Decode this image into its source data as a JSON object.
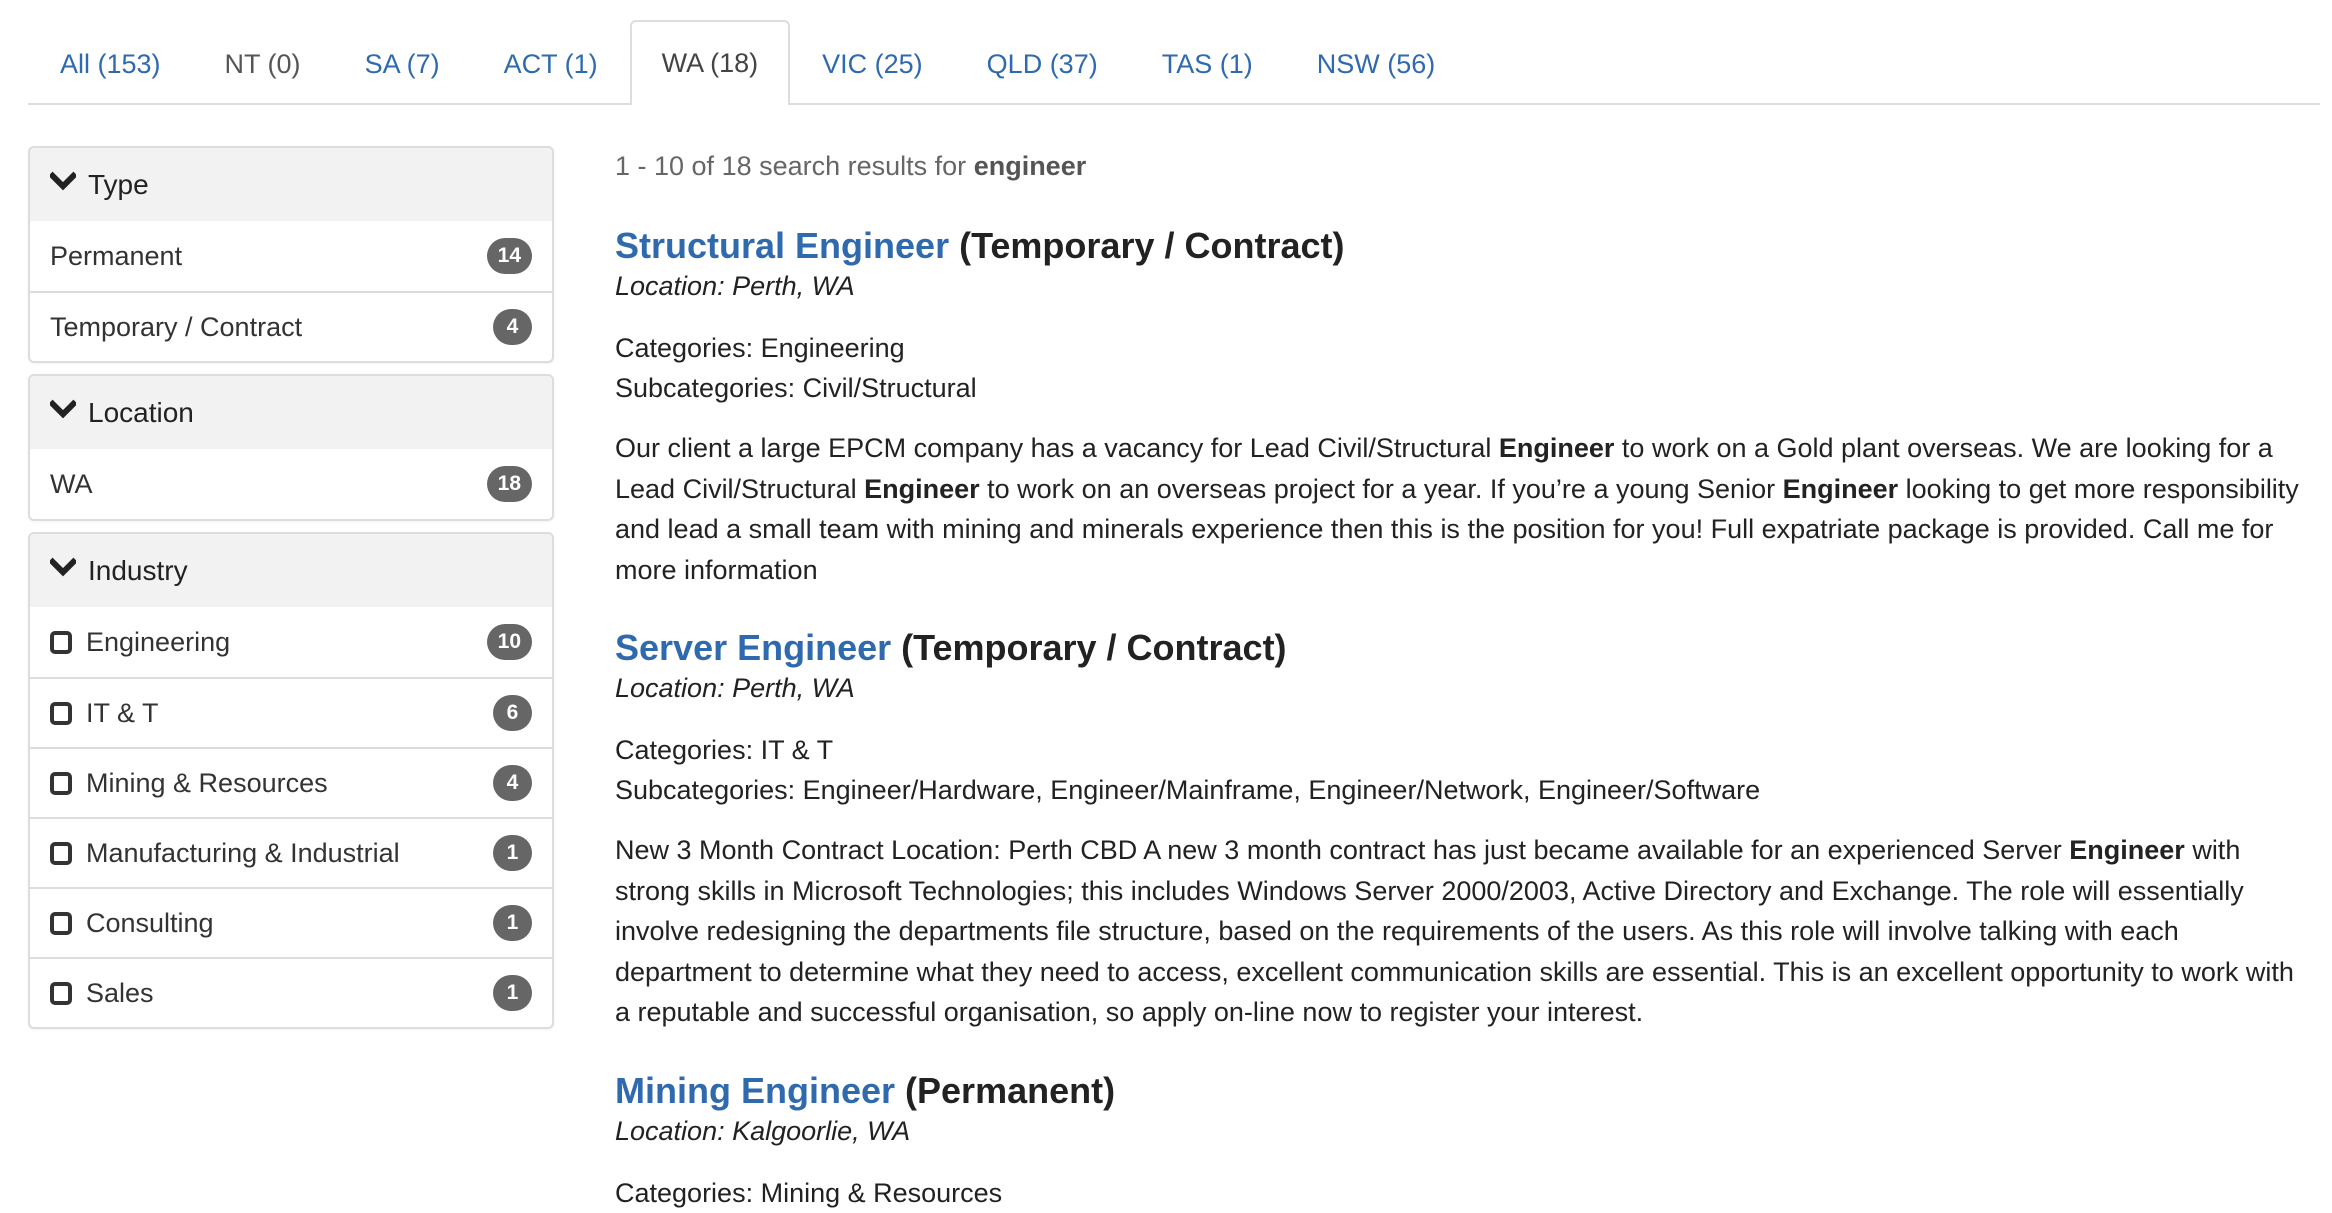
{
  "tabs": [
    {
      "label": "All (153)",
      "state": "link"
    },
    {
      "label": "NT (0)",
      "state": "disabled"
    },
    {
      "label": "SA (7)",
      "state": "link"
    },
    {
      "label": "ACT (1)",
      "state": "link"
    },
    {
      "label": "WA (18)",
      "state": "active"
    },
    {
      "label": "VIC (25)",
      "state": "link"
    },
    {
      "label": "QLD (37)",
      "state": "link"
    },
    {
      "label": "TAS (1)",
      "state": "link"
    },
    {
      "label": "NSW (56)",
      "state": "link"
    }
  ],
  "filters": {
    "type": {
      "title": "Type",
      "icon": "chevron-down-icon",
      "items": [
        {
          "label": "Permanent",
          "count": "14"
        },
        {
          "label": "Temporary / Contract",
          "count": "4"
        }
      ]
    },
    "location": {
      "title": "Location",
      "icon": "chevron-down-icon",
      "items": [
        {
          "label": "WA",
          "count": "18"
        }
      ]
    },
    "industry": {
      "title": "Industry",
      "icon": "chevron-down-icon",
      "items": [
        {
          "label": "Engineering",
          "count": "10",
          "checked": false
        },
        {
          "label": "IT & T",
          "count": "6",
          "checked": false
        },
        {
          "label": "Mining & Resources",
          "count": "4",
          "checked": false
        },
        {
          "label": "Manufacturing & Industrial",
          "count": "1",
          "checked": false
        },
        {
          "label": "Consulting",
          "count": "1",
          "checked": false
        },
        {
          "label": "Sales",
          "count": "1",
          "checked": false
        }
      ]
    }
  },
  "results": {
    "summary_prefix": "1 - 10 of 18 search results for ",
    "query": "engineer",
    "jobs": [
      {
        "title": "Structural Engineer",
        "type": "(Temporary / Contract)",
        "location": "Location: Perth, WA",
        "categories": "Categories: Engineering",
        "subcategories": "Subcategories: Civil/Structural",
        "description": [
          {
            "t": "Our client a large EPCM company has a vacancy for Lead Civil/Structural ",
            "b": false
          },
          {
            "t": "Engineer",
            "b": true
          },
          {
            "t": " to work on a Gold plant overseas. We are looking for a Lead Civil/Structural ",
            "b": false
          },
          {
            "t": "Engineer",
            "b": true
          },
          {
            "t": " to work on an overseas project for a year. If you’re a young Senior ",
            "b": false
          },
          {
            "t": "Engineer",
            "b": true
          },
          {
            "t": " looking to get more responsibility and lead a small team with mining and minerals experience then this is the position for you! Full expatriate package is provided. Call me for more information",
            "b": false
          }
        ]
      },
      {
        "title": "Server Engineer",
        "type": "(Temporary / Contract)",
        "location": "Location: Perth, WA",
        "categories": "Categories: IT & T",
        "subcategories": "Subcategories: Engineer/Hardware, Engineer/Mainframe, Engineer/Network, Engineer/Software",
        "description": [
          {
            "t": "New 3 Month Contract Location: Perth CBD A new 3 month contract has just became available for an experienced Server ",
            "b": false
          },
          {
            "t": "Engineer",
            "b": true
          },
          {
            "t": " with strong skills in Microsoft Technologies; this includes Windows Server 2000/2003, Active Directory and Exchange. The role will essentially involve redesigning the departments file structure, based on the requirements of the users. As this role will involve talking with each department to determine what they need to access, excellent communication skills are essential. This is an excellent opportunity to work with a reputable and successful organisation, so apply on-line now to register your interest.",
            "b": false
          }
        ]
      },
      {
        "title": "Mining Engineer",
        "type": "(Permanent)",
        "location": "Location: Kalgoorlie, WA",
        "categories": "Categories: Mining & Resources",
        "subcategories": "",
        "description": []
      }
    ]
  },
  "colors": {
    "link": "#2f6aae",
    "badge": "#666666",
    "panel_header": "#f2f2f2",
    "border": "#dddddd"
  }
}
